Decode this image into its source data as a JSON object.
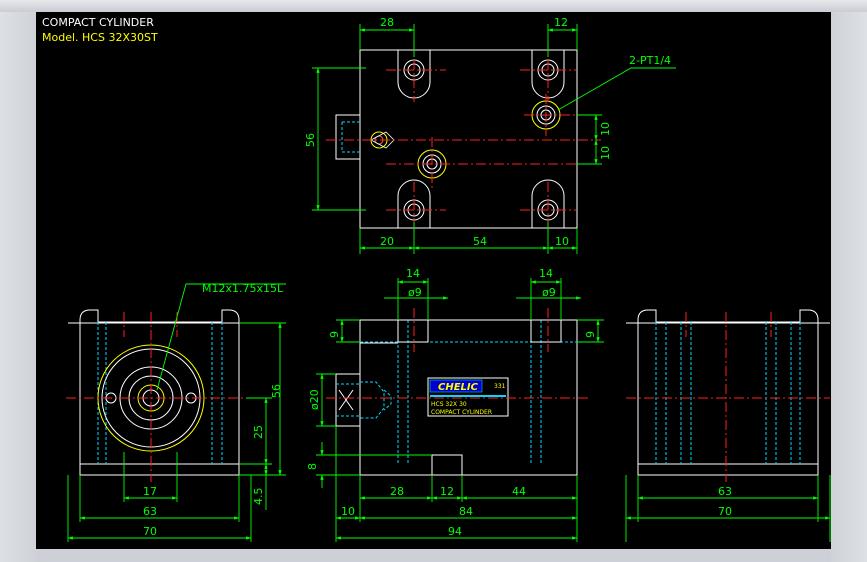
{
  "header": {
    "title": "COMPACT CYLINDER",
    "model": "Model. HCS 32X30ST"
  },
  "colors": {
    "background": "#000000",
    "outline": "#ffffff",
    "dimension": "#00ff00",
    "center": "#ff2020",
    "hidden": "#00d8ff",
    "accent": "#ffff00"
  },
  "top_view": {
    "dims": {
      "w28": "28",
      "w12": "12",
      "port": "2-PT1/4",
      "h56": "56",
      "h10a": "10",
      "h10b": "10",
      "b20": "20",
      "b54": "54",
      "b10": "10"
    }
  },
  "left_view": {
    "dims": {
      "thread": "M12x1.75x15L",
      "d56": "56",
      "d25": "25",
      "d45": "4.5",
      "d17": "17",
      "d63": "63",
      "d70": "70"
    }
  },
  "front_view": {
    "dims": {
      "c14a": "14",
      "c9a": "ø9",
      "c14b": "14",
      "c9b": "ø9",
      "v9a": "9",
      "v9b": "9",
      "d20": "ø20",
      "v8": "8",
      "b28": "28",
      "b12": "12",
      "b44": "44",
      "b10": "10",
      "b84": "84",
      "b94": "94"
    },
    "label": {
      "brand": "CHELIC",
      "size": "331",
      "model": "HCS 32X 30",
      "name": "COMPACT CYLINDER"
    }
  },
  "right_view": {
    "dims": {
      "d63": "63",
      "d70": "70"
    }
  }
}
